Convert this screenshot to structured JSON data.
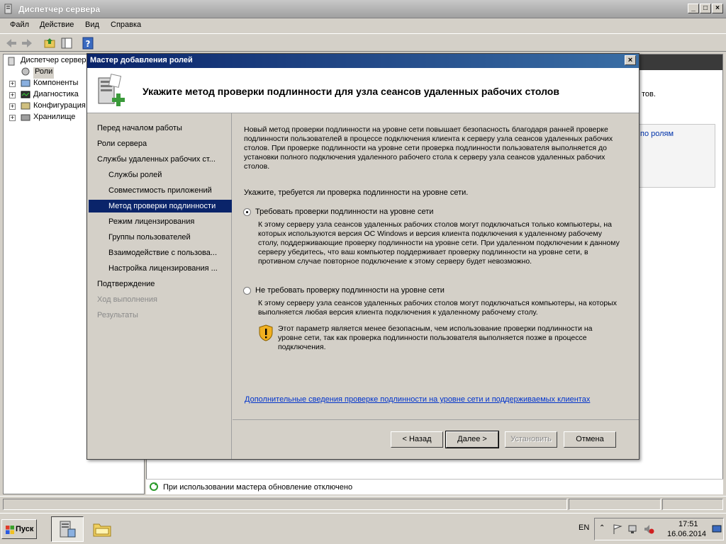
{
  "app": {
    "title": "Диспетчер сервера",
    "menu": [
      "Файл",
      "Действие",
      "Вид",
      "Справка"
    ]
  },
  "tree": {
    "root": "Диспетчер сервера",
    "items": [
      "Роли",
      "Компоненты",
      "Диагностика",
      "Конфигурация",
      "Хранилище"
    ]
  },
  "right_pane": {
    "text_fragment": "тов.",
    "link_fragment": "по ролям"
  },
  "status": {
    "text": "При использовании мастера обновление отключено"
  },
  "wizard": {
    "title": "Мастер добавления ролей",
    "heading": "Укажите метод проверки подлинности для узла сеансов удаленных рабочих столов",
    "nav": [
      {
        "label": "Перед началом работы",
        "state": "normal",
        "indent": false
      },
      {
        "label": "Роли сервера",
        "state": "normal",
        "indent": false
      },
      {
        "label": "Службы удаленных рабочих ст...",
        "state": "normal",
        "indent": false
      },
      {
        "label": "Службы ролей",
        "state": "normal",
        "indent": true
      },
      {
        "label": "Совместимость приложений",
        "state": "normal",
        "indent": true
      },
      {
        "label": "Метод проверки подлинности",
        "state": "active",
        "indent": true
      },
      {
        "label": "Режим лицензирования",
        "state": "normal",
        "indent": true
      },
      {
        "label": "Группы пользователей",
        "state": "normal",
        "indent": true
      },
      {
        "label": "Взаимодействие с пользова...",
        "state": "normal",
        "indent": true
      },
      {
        "label": "Настройка лицензирования ...",
        "state": "normal",
        "indent": true
      },
      {
        "label": "Подтверждение",
        "state": "normal",
        "indent": false
      },
      {
        "label": "Ход выполнения",
        "state": "disabled",
        "indent": false
      },
      {
        "label": "Результаты",
        "state": "disabled",
        "indent": false
      }
    ],
    "intro": "Новый метод проверки подлинности на уровне сети повышает безопасность благодаря ранней проверке подлинности пользователей в процессе подключения клиента к серверу узла сеансов удаленных рабочих столов. При проверке подлинности на уровне сети проверка подлинности пользователя выполняется до установки полного подключения удаленного рабочего стола к серверу узла сеансов удаленных рабочих столов.",
    "question": "Укажите, требуется ли проверка подлинности на уровне сети.",
    "option1": {
      "label": "Требовать проверки подлинности на уровне сети",
      "checked": true,
      "desc": "К этому серверу узла сеансов удаленных рабочих столов могут подключаться только компьютеры, на которых используются версия ОС Windows и версия клиента подключения к удаленному рабочему столу, поддерживающие проверку подлинности на уровне сети. При удаленном подключении к данному серверу убедитесь, что ваш компьютер поддерживает проверку подлинности на уровне сети, в противном случае повторное подключение к этому серверу будет невозможно."
    },
    "option2": {
      "label": "Не требовать проверку подлинности на уровне сети",
      "checked": false,
      "desc": "К этому серверу узла сеансов удаленных рабочих столов могут подключаться компьютеры, на которых выполняется любая версия клиента подключения к удаленному рабочему столу.",
      "warning": "Этот параметр является менее безопасным, чем использование проверки подлинности на уровне сети, так как проверка подлинности пользователя выполняется позже в процессе подключения."
    },
    "link": "Дополнительные сведения проверке подлинности на уровне сети и поддерживаемых клиентах",
    "buttons": {
      "back": "< Назад",
      "next": "Далее >",
      "install": "Установить",
      "cancel": "Отмена"
    }
  },
  "taskbar": {
    "start": "Пуск",
    "lang": "EN",
    "time": "17:51",
    "date": "16.06.2014"
  },
  "colors": {
    "selection": "#0a246a",
    "link": "#0033cc",
    "dialog_bg": "#d4d0c8"
  }
}
